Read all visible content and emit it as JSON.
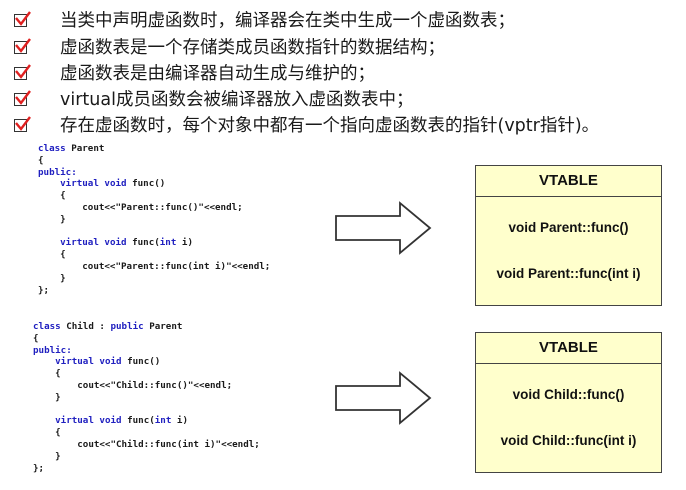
{
  "bullets": [
    "当类中声明虚函数时，编译器会在类中生成一个虚函数表；",
    "虚函数表是一个存储类成员函数指针的数据结构；",
    "虚函数表是由编译器自动生成与维护的；",
    "virtual成员函数会被编译器放入虚函数表中；",
    "存在虚函数时，每个对象中都有一个指向虚函数表的指针(vptr指针)。"
  ],
  "parent_code": {
    "line1_kw": "class",
    "line1_rest": " Parent",
    "open": "{",
    "public": "public:",
    "f1_virtual": "virtual",
    "f1_void": "void",
    "f1_rest": " func()",
    "f1_open": "{",
    "f1_body": "cout<<\"Parent::func()\"<<endl;",
    "f1_close": "}",
    "f2_virtual": "virtual",
    "f2_void": "void",
    "f2_mid": " func(",
    "f2_int": "int",
    "f2_rest": " i)",
    "f2_open": "{",
    "f2_body": "cout<<\"Parent::func(int i)\"<<endl;",
    "f2_close": "}",
    "close": "};"
  },
  "child_code": {
    "line1_kw": "class",
    "line1_mid": " Child : ",
    "line1_pub": "public",
    "line1_rest": " Parent",
    "open": "{",
    "public": "public:",
    "f1_virtual": "virtual",
    "f1_void": "void",
    "f1_rest": " func()",
    "f1_open": "{",
    "f1_body": "cout<<\"Child::func()\"<<endl;",
    "f1_close": "}",
    "f2_virtual": "virtual",
    "f2_void": "void",
    "f2_mid": " func(",
    "f2_int": "int",
    "f2_rest": " i)",
    "f2_open": "{",
    "f2_body": "cout<<\"Child::func(int i)\"<<endl;",
    "f2_close": "}",
    "close": "};"
  },
  "vtables": [
    {
      "title": "VTABLE",
      "items": [
        "void Parent::func()",
        "void Parent::func(int i)"
      ]
    },
    {
      "title": "VTABLE",
      "items": [
        "void Child::func()",
        "void Child::func(int i)"
      ]
    }
  ],
  "colors": {
    "check": "#e02020",
    "keyword": "#2020c0",
    "vtable_fill": "#ffffcc"
  }
}
